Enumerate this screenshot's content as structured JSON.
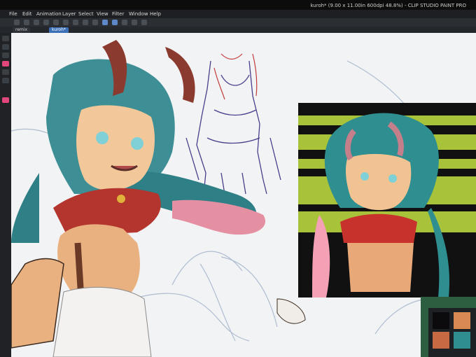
{
  "window": {
    "title": "kuroh* (9.00 x 11.00in 600dpi 48.8%) - CLIP STUDIO PAINT PRO"
  },
  "menu": {
    "items": [
      "File",
      "Edit",
      "Animation",
      "Layer",
      "Select",
      "View",
      "Filter",
      "Window",
      "Help"
    ]
  },
  "tabs": [
    {
      "label": "remix",
      "active": false
    },
    {
      "label": "kuroh*",
      "active": true
    }
  ],
  "toolbar": {
    "icons": [
      "new-icon",
      "open-icon",
      "save-icon",
      "undo-icon",
      "redo-icon",
      "clear-icon",
      "transform-icon",
      "deselect-icon",
      "snap-icon",
      "ruler-icon",
      "pen-icon",
      "eraser-icon",
      "fill-icon",
      "grid-icon"
    ]
  },
  "colors": {
    "accent": "#3b6fb7",
    "tool_active": "#e1477b",
    "canvas": "#f2f3f4",
    "ui_dark": "#1d1f22"
  },
  "palette": {
    "swatches": [
      "#0b0b0d",
      "#d98a53",
      "#c76a43",
      "#2f8e8f",
      "#b1472f",
      "#3c3c40"
    ]
  }
}
